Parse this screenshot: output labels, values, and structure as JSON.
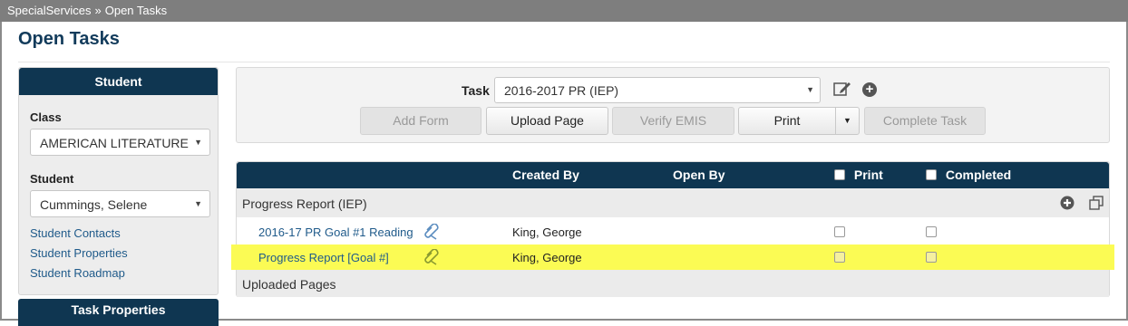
{
  "breadcrumb": {
    "root": "SpecialServices",
    "separator": "»",
    "current": "Open Tasks"
  },
  "page_title": "Open Tasks",
  "sidebar": {
    "header": "Student",
    "class_label": "Class",
    "class_value": "AMERICAN LITERATURE",
    "student_label": "Student",
    "student_value": "Cummings, Selene",
    "links": [
      "Student Contacts",
      "Student Properties",
      "Student Roadmap"
    ],
    "second_header": "Task Properties"
  },
  "task_panel": {
    "task_label": "Task",
    "task_value": "2016-2017 PR (IEP)",
    "icons": [
      "edit-icon",
      "add-icon"
    ],
    "buttons": {
      "add_form": "Add Form",
      "upload_page": "Upload Page",
      "verify_emis": "Verify EMIS",
      "print": "Print",
      "complete_task": "Complete Task"
    }
  },
  "grid": {
    "columns": {
      "created_by": "Created By",
      "open_by": "Open By",
      "print": "Print",
      "completed": "Completed"
    },
    "groups": [
      {
        "title": "Progress Report (IEP)",
        "rows": [
          {
            "name": "2016-17 PR Goal #1 Reading",
            "created_by": "King, George",
            "highlighted": false
          },
          {
            "name": "Progress Report [Goal #]",
            "created_by": "King, George",
            "highlighted": true
          }
        ]
      },
      {
        "title": "Uploaded Pages",
        "rows": []
      }
    ]
  },
  "colors": {
    "header_navy": "#0f3651",
    "highlight": "#fbfb54",
    "link": "#1f5a8a"
  }
}
